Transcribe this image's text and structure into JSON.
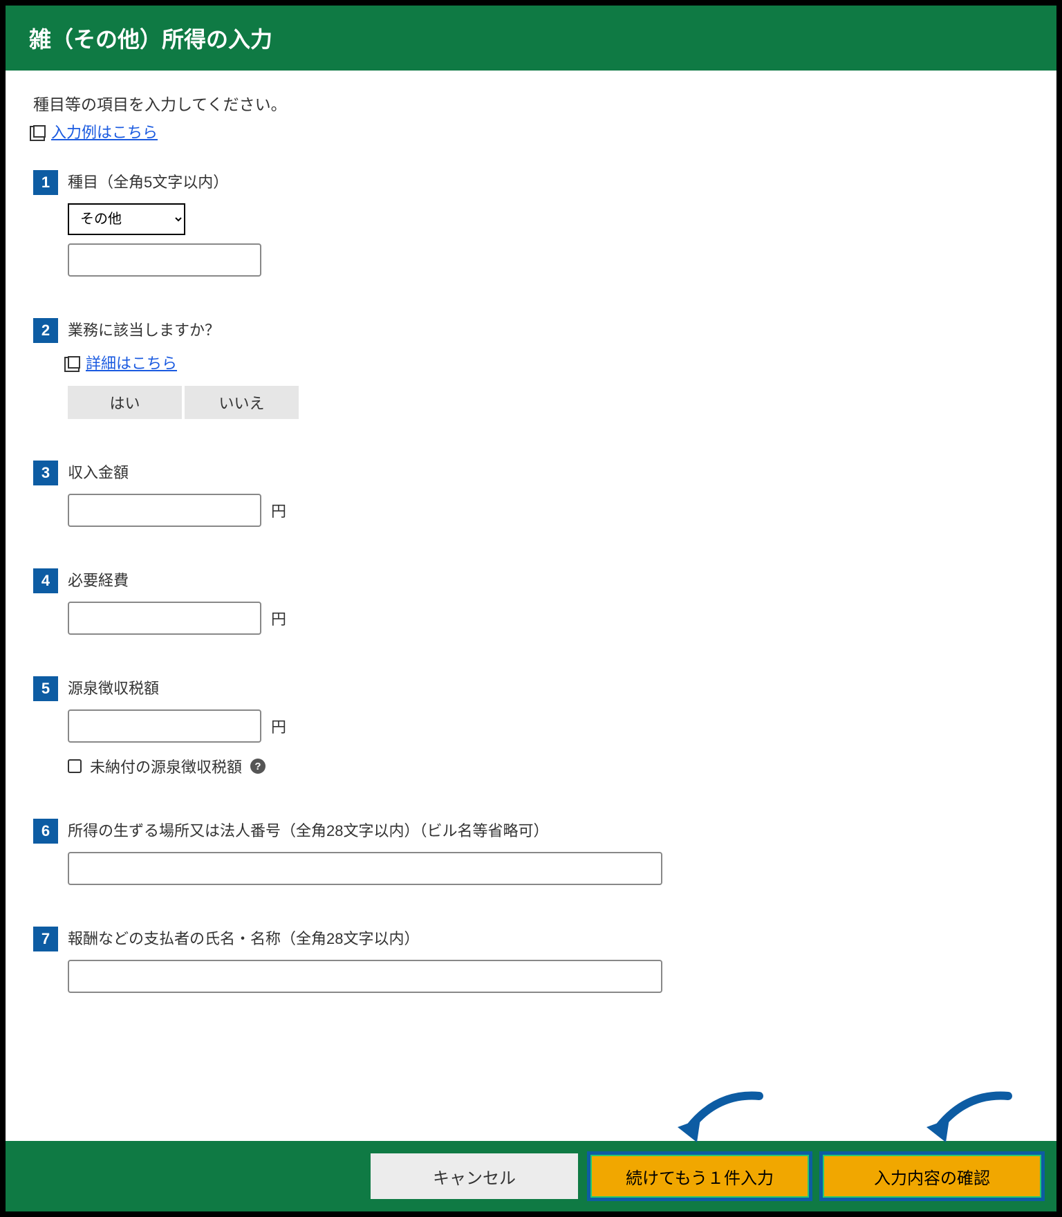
{
  "header": {
    "title": "雑（その他）所得の入力"
  },
  "intro": "種目等の項目を入力してください。",
  "example_link": "入力例はこちら",
  "steps": [
    {
      "num": "1",
      "label": "種目（全角5文字以内）",
      "select_value": "その他"
    },
    {
      "num": "2",
      "label": "業務に該当しますか？",
      "detail_link": "詳細はこちら",
      "yes": "はい",
      "no": "いいえ"
    },
    {
      "num": "3",
      "label": "収入金額",
      "unit": "円"
    },
    {
      "num": "4",
      "label": "必要経費",
      "unit": "円"
    },
    {
      "num": "5",
      "label": "源泉徴収税額",
      "unit": "円",
      "checkbox_label": "未納付の源泉徴収税額",
      "help": "?"
    },
    {
      "num": "6",
      "label": "所得の生ずる場所又は法人番号（全角28文字以内）（ビル名等省略可）"
    },
    {
      "num": "7",
      "label": "報酬などの支払者の氏名・名称（全角28文字以内）"
    }
  ],
  "footer": {
    "cancel": "キャンセル",
    "continue": "続けてもう１件入力",
    "confirm": "入力内容の確認"
  }
}
